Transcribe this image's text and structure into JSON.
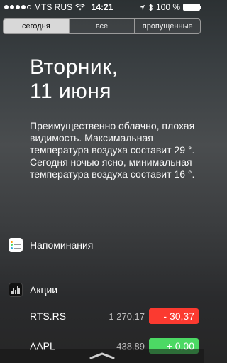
{
  "status_bar": {
    "carrier": "MTS RUS",
    "time": "14:21",
    "battery_text": "100 %",
    "battery_level": 1.0,
    "signal_bars_filled": 4,
    "signal_bars_total": 5
  },
  "segments": [
    {
      "label": "сегодня",
      "active": true
    },
    {
      "label": "все",
      "active": false
    },
    {
      "label": "пропущенные",
      "active": false
    }
  ],
  "date": {
    "weekday": "Вторник,",
    "day": "11 июня"
  },
  "forecast_text": "Преимущественно облачно, плохая видимость. Максимальная температура воздуха составит 29 °. Сегодня ночью ясно, минимальная температура воздуха составит 16 °.",
  "reminders": {
    "label": "Напоминания",
    "icon": "reminders-icon"
  },
  "stocks": {
    "label": "Акции",
    "icon": "stocks-icon",
    "rows": [
      {
        "symbol": "RTS.RS",
        "price": "1 270,17",
        "change": "- 30,37",
        "color": "#fb3a30"
      },
      {
        "symbol": "AAPL",
        "price": "438,89",
        "change": "+ 0,00",
        "color": "#4cd964"
      }
    ]
  },
  "colors": {
    "active_segment": "#d8d8d8",
    "stock_down": "#fb3a30",
    "stock_up": "#4cd964"
  },
  "icons": {
    "location": "location-arrow-icon",
    "bluetooth": "bluetooth-icon",
    "wifi": "wifi-icon",
    "battery": "battery-icon",
    "handle": "chevron-handle-icon"
  }
}
